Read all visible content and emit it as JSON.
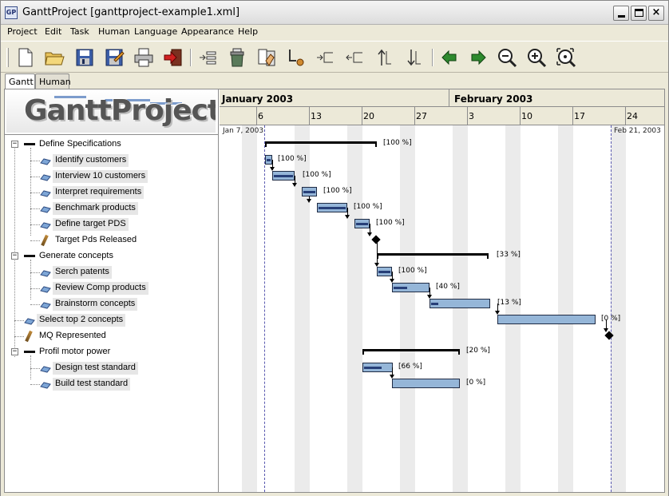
{
  "window": {
    "title": "GanttProject [ganttproject-example1.xml]",
    "app_icon_text": "GP",
    "minimize": "",
    "maximize": "",
    "close": "×"
  },
  "menu": [
    "Project",
    "Edit",
    "Task",
    "Human",
    "Language",
    "Appearance",
    "Help"
  ],
  "toolbar": {
    "icons": [
      "new-document-icon",
      "open-folder-icon",
      "save-icon",
      "save-as-icon",
      "print-icon",
      "exit-icon",
      "new-task-icon",
      "delete-task-icon",
      "task-properties-icon",
      "unlink-icon",
      "indent-icon",
      "outdent-icon",
      "move-up-icon",
      "move-down-icon",
      "scroll-left-icon",
      "scroll-right-icon",
      "zoom-out-icon",
      "zoom-in-icon",
      "zoom-fit-icon"
    ]
  },
  "tabs": [
    "Gantt",
    "Human"
  ],
  "logo": {
    "text": "GanttProject"
  },
  "tasks": [
    {
      "name": "Define Specifications",
      "type": "summary",
      "level": 0,
      "expanded": "−"
    },
    {
      "name": "Identify customers",
      "type": "task",
      "level": 1
    },
    {
      "name": "Interview 10 customers",
      "type": "task",
      "level": 1
    },
    {
      "name": "Interpret requirements",
      "type": "task",
      "level": 1
    },
    {
      "name": "Benchmark products",
      "type": "task",
      "level": 1
    },
    {
      "name": "Define target PDS",
      "type": "task",
      "level": 1
    },
    {
      "name": "Target Pds Released",
      "type": "milestone",
      "level": 1
    },
    {
      "name": "Generate concepts",
      "type": "summary",
      "level": 0,
      "expanded": "−"
    },
    {
      "name": "Serch patents",
      "type": "task",
      "level": 1
    },
    {
      "name": "Review Comp products",
      "type": "task",
      "level": 1
    },
    {
      "name": "Brainstorm concepts",
      "type": "task",
      "level": 1
    },
    {
      "name": "Select top 2 concepts",
      "type": "task",
      "level": 0
    },
    {
      "name": "MQ Represented",
      "type": "milestone",
      "level": 0
    },
    {
      "name": "Profil motor power",
      "type": "summary",
      "level": 0,
      "expanded": "−"
    },
    {
      "name": "Design test standard",
      "type": "task",
      "level": 1
    },
    {
      "name": "Build test standard",
      "type": "task",
      "level": 1
    }
  ],
  "chart": {
    "months": [
      "January 2003",
      "February 2003"
    ],
    "days": [
      "6",
      "13",
      "20",
      "27",
      "3",
      "10",
      "17",
      "24"
    ],
    "range_start": "Jan 7, 2003",
    "range_end": "Feb 21, 2003",
    "percents": [
      "[100 %]",
      "[100 %]",
      "[100 %]",
      "[100 %]",
      "[100 %]",
      "[100 %]",
      "",
      "[33 %]",
      "[100 %]",
      "[40 %]",
      "[13 %]",
      "[0 %]",
      "",
      "[20 %]",
      "[66 %]",
      "[0 %]"
    ]
  }
}
